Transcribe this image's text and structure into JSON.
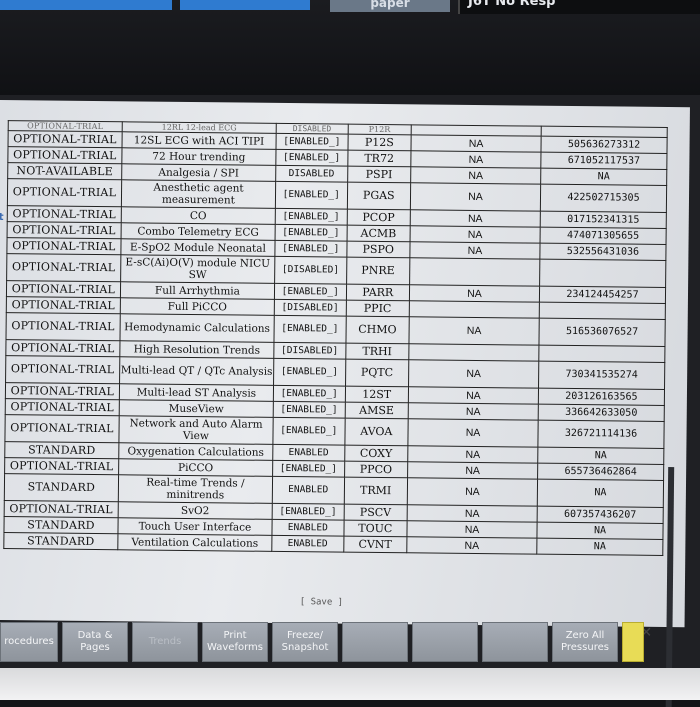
{
  "top": {
    "paper_label": "paper",
    "no_resp_label": "J6T No Resp"
  },
  "side_mark": "t",
  "clipped_row": {
    "status": "OPTIONAL-TRIAL",
    "feature": "12RL 12-lead ECG",
    "state": "DISABLED",
    "code": "P12R"
  },
  "rows": [
    {
      "status": "OPTIONAL-TRIAL",
      "feature": "12SL ECG with ACI TIPI",
      "state": "[ENABLED_]",
      "code": "P12S",
      "v1": "NA",
      "v2": "505636273312"
    },
    {
      "status": "OPTIONAL-TRIAL",
      "feature": "72 Hour trending",
      "state": "[ENABLED_]",
      "code": "TR72",
      "v1": "NA",
      "v2": "671052117537"
    },
    {
      "status": "NOT-AVAILABLE",
      "feature": "Analgesia / SPI",
      "state": "DISABLED",
      "code": "PSPI",
      "v1": "NA",
      "v2": "NA"
    },
    {
      "status": "OPTIONAL-TRIAL",
      "feature": "Anesthetic agent measurement",
      "state": "[ENABLED_]",
      "code": "PGAS",
      "v1": "NA",
      "v2": "422502715305",
      "tall": true
    },
    {
      "status": "OPTIONAL-TRIAL",
      "feature": "CO",
      "state": "[ENABLED_]",
      "code": "PCOP",
      "v1": "NA",
      "v2": "017152341315"
    },
    {
      "status": "OPTIONAL-TRIAL",
      "feature": "Combo Telemetry ECG",
      "state": "[ENABLED_]",
      "code": "ACMB",
      "v1": "NA",
      "v2": "474071305655"
    },
    {
      "status": "OPTIONAL-TRIAL",
      "feature": "E-SpO2 Module Neonatal",
      "state": "[ENABLED_]",
      "code": "PSPO",
      "v1": "NA",
      "v2": "532556431036"
    },
    {
      "status": "OPTIONAL-TRIAL",
      "feature": "E-sC(Ai)O(V) module NICU SW",
      "state": "[DISABLED]",
      "code": "PNRE",
      "v1": "",
      "v2": "",
      "tall": true
    },
    {
      "status": "OPTIONAL-TRIAL",
      "feature": "Full Arrhythmia",
      "state": "[ENABLED_]",
      "code": "PARR",
      "v1": "NA",
      "v2": "234124454257"
    },
    {
      "status": "OPTIONAL-TRIAL",
      "feature": "Full PiCCO",
      "state": "[DISABLED]",
      "code": "PPIC",
      "v1": "",
      "v2": ""
    },
    {
      "status": "OPTIONAL-TRIAL",
      "feature": "Hemodynamic Calculations",
      "state": "[ENABLED_]",
      "code": "CHMO",
      "v1": "NA",
      "v2": "516536076527",
      "tall": true
    },
    {
      "status": "OPTIONAL-TRIAL",
      "feature": "High Resolution Trends",
      "state": "[DISABLED]",
      "code": "TRHI",
      "v1": "",
      "v2": ""
    },
    {
      "status": "OPTIONAL-TRIAL",
      "feature": "Multi-lead QT / QTc Analysis",
      "state": "[ENABLED_]",
      "code": "PQTC",
      "v1": "NA",
      "v2": "730341535274",
      "tall": true
    },
    {
      "status": "OPTIONAL-TRIAL",
      "feature": "Multi-lead ST Analysis",
      "state": "[ENABLED_]",
      "code": "12ST",
      "v1": "NA",
      "v2": "203126163565"
    },
    {
      "status": "OPTIONAL-TRIAL",
      "feature": "MuseView",
      "state": "[ENABLED_]",
      "code": "AMSE",
      "v1": "NA",
      "v2": "336642633050"
    },
    {
      "status": "OPTIONAL-TRIAL",
      "feature": "Network and Auto Alarm View",
      "state": "[ENABLED_]",
      "code": "AVOA",
      "v1": "NA",
      "v2": "326721114136",
      "tall": true
    },
    {
      "status": "STANDARD",
      "feature": "Oxygenation Calculations",
      "state": "ENABLED",
      "code": "COXY",
      "v1": "NA",
      "v2": "NA"
    },
    {
      "status": "OPTIONAL-TRIAL",
      "feature": "PiCCO",
      "state": "[ENABLED_]",
      "code": "PPCO",
      "v1": "NA",
      "v2": "655736462864"
    },
    {
      "status": "STANDARD",
      "feature": "Real-time Trends / minitrends",
      "state": "ENABLED",
      "code": "TRMI",
      "v1": "NA",
      "v2": "NA",
      "tall": true
    },
    {
      "status": "OPTIONAL-TRIAL",
      "feature": "SvO2",
      "state": "[ENABLED_]",
      "code": "PSCV",
      "v1": "NA",
      "v2": "607357436207"
    },
    {
      "status": "STANDARD",
      "feature": "Touch User Interface",
      "state": "ENABLED",
      "code": "TOUC",
      "v1": "NA",
      "v2": "NA"
    },
    {
      "status": "STANDARD",
      "feature": "Ventilation Calculations",
      "state": "ENABLED",
      "code": "CVNT",
      "v1": "NA",
      "v2": "NA"
    }
  ],
  "save_label": "[ Save ]",
  "softkeys": [
    {
      "label": "rocedures",
      "dim": false
    },
    {
      "label": "Data & Pages",
      "dim": false
    },
    {
      "label": "Trends",
      "dim": true
    },
    {
      "label": "Print Waveforms",
      "dim": false
    },
    {
      "label": "Freeze/ Snapshot",
      "dim": false
    },
    {
      "label": "",
      "dim": true
    },
    {
      "label": "",
      "dim": true
    },
    {
      "label": "",
      "dim": true
    },
    {
      "label": "Zero All Pressures",
      "dim": false
    },
    {
      "label": "",
      "warn": true
    }
  ]
}
